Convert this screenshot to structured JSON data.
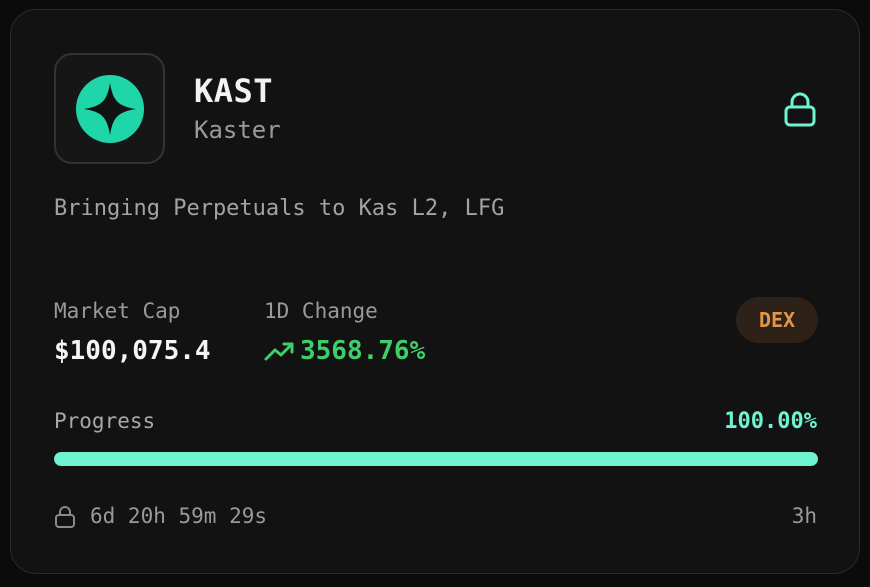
{
  "token": {
    "ticker": "KAST",
    "name": "Kaster",
    "description": "Bringing Perpetuals to Kas L2, LFG",
    "logo_icon": "kaster-star-logo",
    "lock_icon": "lock-icon"
  },
  "stats": {
    "market_cap_label": "Market Cap",
    "market_cap_value": "$100,075.4",
    "change_label": "1D Change",
    "change_value": "3568.76%",
    "change_icon": "trending-up-icon",
    "change_color": "#3ecf6a"
  },
  "badge": {
    "label": "DEX",
    "color": "#e2954c"
  },
  "progress": {
    "label": "Progress",
    "value_text": "100.00%",
    "fraction": 1.0,
    "color": "#6ff2cf"
  },
  "footer": {
    "countdown": "6d 20h 59m 29s",
    "age": "3h"
  }
}
